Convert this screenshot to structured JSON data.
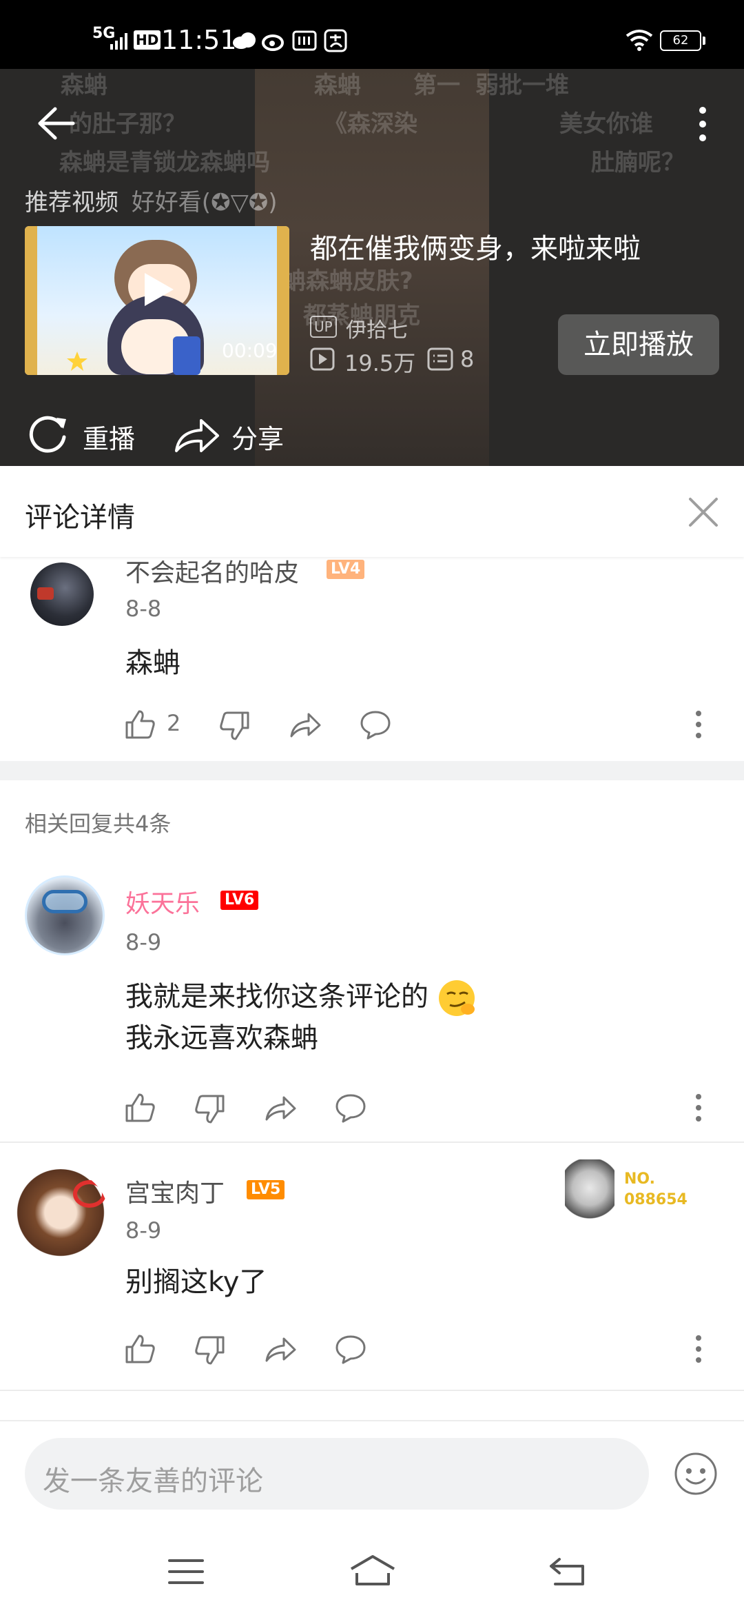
{
  "status_bar": {
    "network": "5G",
    "hd": "HD",
    "time": "11:51",
    "battery": "62"
  },
  "video": {
    "danmaku": [
      "森蚺",
      "森蚺",
      "第一",
      "弱批一堆",
      "的肚子那？",
      "《森深染",
      "美女你谁",
      "森蚺是青锁龙森蚺吗",
      "肚腩呢？",
      "好好看(✪▽✪)",
      "蚺森蚺皮肤?",
      "都蒸蚺朋克"
    ],
    "recommend_label": "推荐视频",
    "rec_title": "都在催我俩变身，来啦来啦",
    "up_badge": "UP",
    "uploader": "伊拾七",
    "plays": "19.5万",
    "comments": "8",
    "duration": "00:09",
    "play_now": "立即播放",
    "replay": "重播",
    "share": "分享"
  },
  "comment_detail": {
    "title": "评论详情",
    "root": {
      "username": "不会起名的哈皮",
      "level": "LV4",
      "date": "8-8",
      "content": "森蚺",
      "likes": "2"
    },
    "replies_label": "相关回复共4条",
    "replies": [
      {
        "username": "妖天乐",
        "level": "LV6",
        "date": "8-9",
        "content_line1": "我就是来找你这条评论的",
        "content_line2": "我永远喜欢森蚺"
      },
      {
        "username": "宫宝肉丁",
        "level": "LV5",
        "date": "8-9",
        "content_line1": "别搁这ky了",
        "fan_no_label": "NO.",
        "fan_no": "088654"
      }
    ]
  },
  "input": {
    "placeholder": "发一条友善的评论"
  },
  "colors": {
    "pink_name": "#fb7299",
    "lv4": "#ffb37c",
    "lv5": "#ff8c00",
    "lv6": "#ff0000",
    "fan_gold": "#e8b923"
  }
}
